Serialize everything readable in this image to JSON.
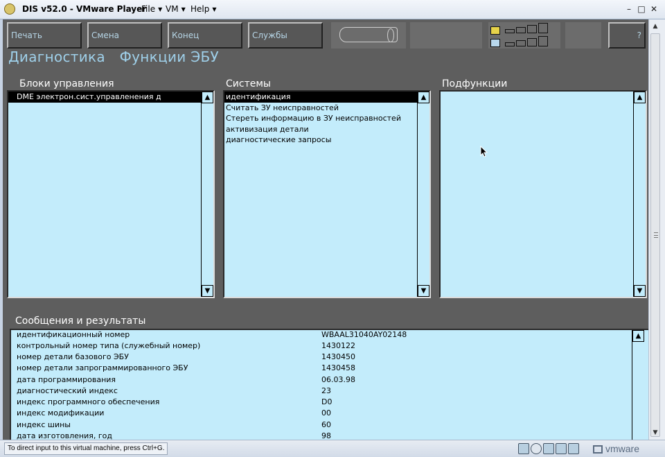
{
  "window": {
    "title": "DIS v52.0 - VMware Player",
    "menus": [
      {
        "label": "File"
      },
      {
        "label": "VM"
      },
      {
        "label": "Help"
      }
    ]
  },
  "toolbar": {
    "buttons": [
      {
        "label": "Печать"
      },
      {
        "label": "Смена"
      },
      {
        "label": "Конец"
      },
      {
        "label": "Службы"
      }
    ],
    "help_button": "?"
  },
  "heading": {
    "part1": "Диагностика",
    "part2": "Функции ЭБУ"
  },
  "panels": {
    "control_units": {
      "label": "Блоки управления",
      "items": [
        "DME электрон.сист.управленения д"
      ],
      "selected_index": 0
    },
    "systems": {
      "label": "Системы",
      "items": [
        "идентификация",
        "Считать ЗУ неисправностей",
        "Стереть информацию в ЗУ неисправностей",
        "активизация детали",
        "диагностические запросы"
      ],
      "selected_index": 0
    },
    "subfunctions": {
      "label": "Подфункции",
      "items": []
    }
  },
  "results": {
    "label": "Сообщения и результаты",
    "rows": [
      {
        "name": "идентификационный номер",
        "value": "WBAAL31040AY02148"
      },
      {
        "name": "контрольный номер типа (служебный номер)",
        "value": "1430122"
      },
      {
        "name": "номер детали базового ЭБУ",
        "value": "1430450"
      },
      {
        "name": "номер детали запрограммированного ЭБУ",
        "value": "1430458"
      },
      {
        "name": "дата программирования",
        "value": "06.03.98"
      },
      {
        "name": "диагностический индекс",
        "value": "23"
      },
      {
        "name": "индекс программного обеспечения",
        "value": "D0"
      },
      {
        "name": "индекс модификации",
        "value": "00"
      },
      {
        "name": "индекс шины",
        "value": "60"
      },
      {
        "name": "дата изготовления, год",
        "value": "98"
      }
    ]
  },
  "statusbar": {
    "hint": "To direct input to this virtual machine, press Ctrl+G.",
    "brand": "vmware"
  },
  "colors": {
    "guest_background": "#5e5e5e",
    "list_background": "#c3ecfb",
    "heading_text": "#9fd0ea",
    "button_text": "#b6d5e6"
  }
}
